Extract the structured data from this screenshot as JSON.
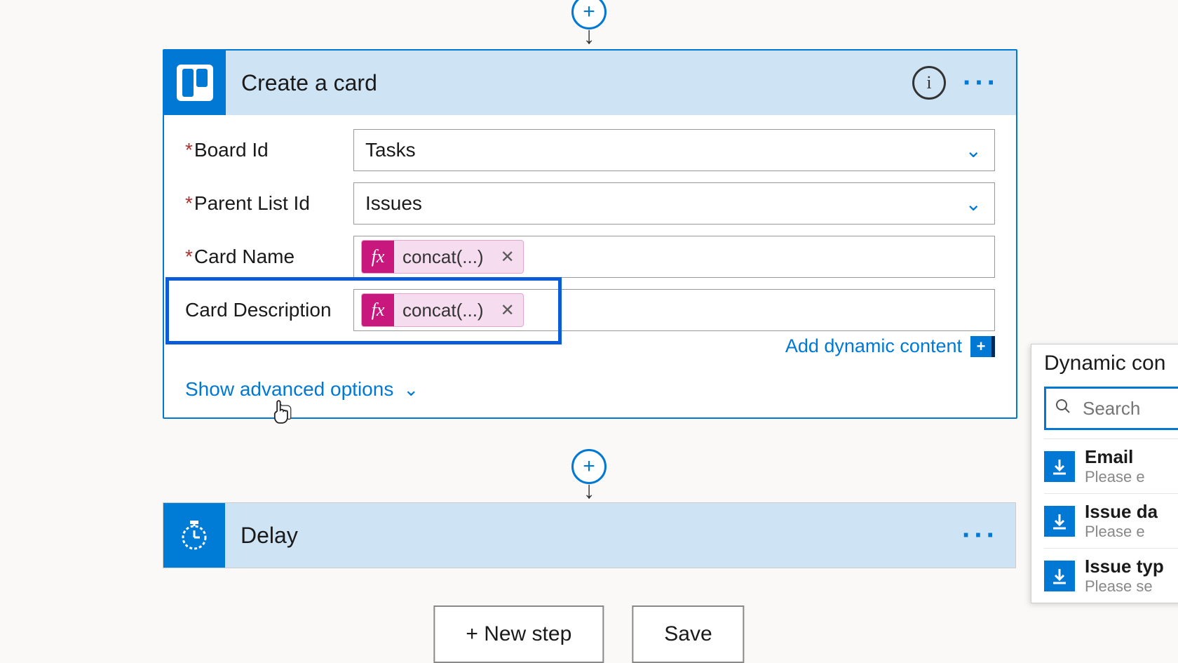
{
  "action": {
    "title": "Create a card",
    "fields": {
      "board": {
        "label": "Board Id",
        "value": "Tasks",
        "required": true
      },
      "parentList": {
        "label": "Parent List Id",
        "value": "Issues",
        "required": true
      },
      "cardName": {
        "label": "Card Name",
        "token": "concat(...)",
        "required": true
      },
      "cardDesc": {
        "label": "Card Description",
        "token": "concat(...)",
        "required": false
      }
    },
    "addDynamic": "Add dynamic content",
    "showAdvanced": "Show advanced options"
  },
  "delay": {
    "title": "Delay"
  },
  "buttons": {
    "newStep": "+ New step",
    "save": "Save"
  },
  "dynamicPanel": {
    "title": "Dynamic con",
    "searchPlaceholder": "Search",
    "items": [
      {
        "title": "Email",
        "sub": "Please e"
      },
      {
        "title": "Issue da",
        "sub": "Please e"
      },
      {
        "title": "Issue typ",
        "sub": "Please se"
      }
    ]
  }
}
